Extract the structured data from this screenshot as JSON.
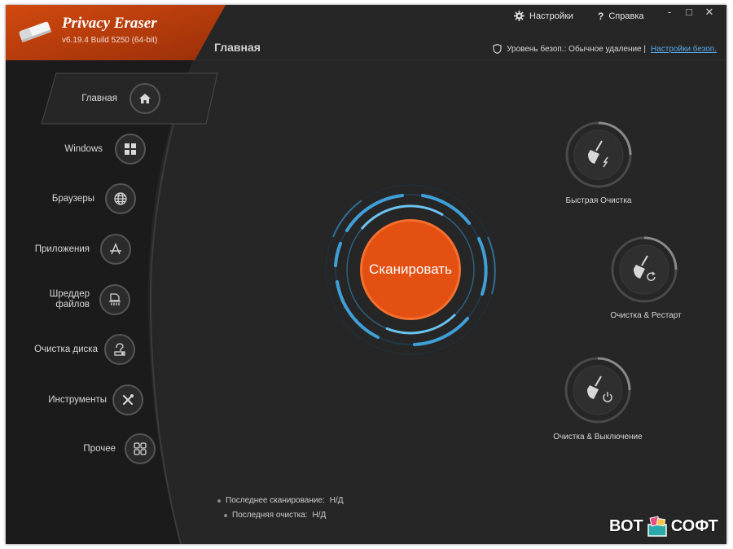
{
  "app": {
    "name": "Privacy Eraser",
    "version": "v6.19.4 Build 5250 (64-bit)"
  },
  "topbar": {
    "settings_label": "Настройки",
    "help_label": "Справка",
    "minimize": "‐",
    "maximize": "□",
    "close": "✕"
  },
  "header": {
    "page_title": "Главная",
    "security_text": "Уровень безоп.: Обычное удаление |",
    "security_link": "Настройки безоп."
  },
  "sidebar": {
    "items": [
      {
        "label": "Главная",
        "icon": "home-icon"
      },
      {
        "label": "Windows",
        "icon": "windows-icon"
      },
      {
        "label": "Браузеры",
        "icon": "globe-icon"
      },
      {
        "label": "Приложения",
        "icon": "apps-icon"
      },
      {
        "label": "Шреддер\nфайлов",
        "icon": "shredder-icon"
      },
      {
        "label": "Очистка диска",
        "icon": "disk-clean-icon"
      },
      {
        "label": "Инструменты",
        "icon": "tools-icon"
      },
      {
        "label": "Прочее",
        "icon": "grid-icon"
      }
    ]
  },
  "main": {
    "scan_label": "Сканировать",
    "actions": [
      {
        "label": "Быстрая Очистка",
        "icon": "broom-bolt-icon"
      },
      {
        "label": "Очистка & Рестарт",
        "icon": "broom-restart-icon"
      },
      {
        "label": "Очистка & Выключение",
        "icon": "broom-power-icon"
      }
    ],
    "stats": {
      "last_scan_label": "Последнее сканирование:",
      "last_scan_value": "Н/Д",
      "last_clean_label": "Последняя очистка:",
      "last_clean_value": "Н/Д"
    }
  },
  "watermark": {
    "left": "ВОТ",
    "right": "СОФТ"
  },
  "colors": {
    "brand_orange": "#c2410c",
    "scan_orange": "#e44f12",
    "ring_blue": "#3fa0d8",
    "background": "#262626",
    "link_blue": "#59a9e8"
  }
}
